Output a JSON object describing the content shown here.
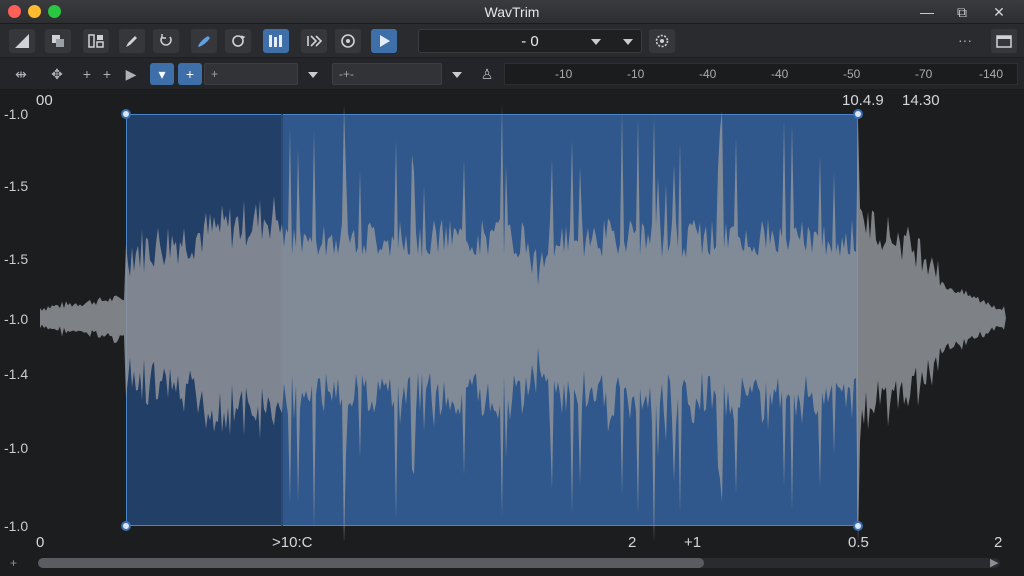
{
  "window": {
    "title": "WavTrim",
    "controls": {
      "minimize": "—",
      "restore": "⧉",
      "close": "✕"
    }
  },
  "toolbar": {
    "level_value": "- 0",
    "more_label": "···"
  },
  "toolbar2": {
    "field1_text": "+",
    "field2_text": "-+-",
    "ruler_ticks": [
      "-10",
      "-10",
      "-40",
      "-40",
      "-50",
      "-70",
      "-140"
    ]
  },
  "waveform": {
    "y_labels": [
      "-1.0",
      "-1.5",
      "-1.5",
      "-1.0",
      "-1.4",
      "-1.0",
      "-1.0"
    ],
    "top_left_time": "00",
    "top_right_times": [
      "10.4.9",
      "14.30"
    ],
    "bottom_labels": {
      "start": "0",
      "mid": ">10:C",
      "mark1": "2",
      "mark2": "+1",
      "end_sel": "0.5",
      "end": "2"
    },
    "selection_color": "#3668a8",
    "wave_color": "#8f9399"
  },
  "scrollbar": {
    "position_fraction": 0.0,
    "visible_fraction": 0.69
  }
}
